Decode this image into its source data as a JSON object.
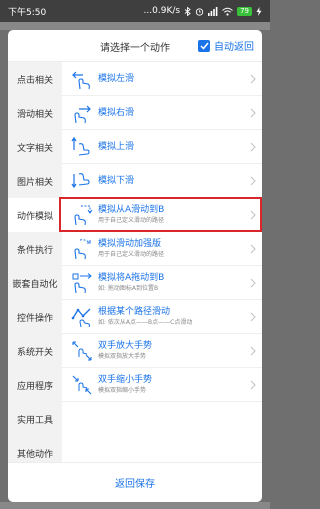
{
  "status": {
    "time": "下午5:50",
    "network": "...0.9K/s",
    "battery": "79"
  },
  "dialog": {
    "title": "请选择一个动作",
    "auto_return_label": "自动返回",
    "auto_return_checked": true,
    "save_label": "返回保存"
  },
  "sidebar": {
    "items": [
      {
        "label": "点击相关"
      },
      {
        "label": "滑动相关"
      },
      {
        "label": "文字相关"
      },
      {
        "label": "图片相关"
      },
      {
        "label": "动作模拟",
        "active": true
      },
      {
        "label": "条件执行"
      },
      {
        "label": "嵌套自动化"
      },
      {
        "label": "控件操作"
      },
      {
        "label": "系统开关"
      },
      {
        "label": "应用程序"
      },
      {
        "label": "实用工具"
      },
      {
        "label": "其他动作"
      }
    ]
  },
  "actions": [
    {
      "title": "模拟左滑",
      "subtitle": "",
      "icon": "swipe-left-icon"
    },
    {
      "title": "模拟右滑",
      "subtitle": "",
      "icon": "swipe-right-icon"
    },
    {
      "title": "模拟上滑",
      "subtitle": "",
      "icon": "swipe-up-icon"
    },
    {
      "title": "模拟下滑",
      "subtitle": "",
      "icon": "swipe-down-icon"
    },
    {
      "title": "模拟从A滑动到B",
      "subtitle": "用于自己定义滑动的路径",
      "icon": "swipe-a-to-b-icon",
      "highlighted": true
    },
    {
      "title": "模拟滑动加强版",
      "subtitle": "用于自己定义滑动的路径",
      "icon": "swipe-enhanced-icon"
    },
    {
      "title": "模拟将A拖动到B",
      "subtitle": "如: 拖动图标A到位置B",
      "icon": "drag-a-to-b-icon"
    },
    {
      "title": "根据某个路径滑动",
      "subtitle": "如: 依次从A点——B点——C点滑动",
      "icon": "path-swipe-icon"
    },
    {
      "title": "双手放大手势",
      "subtitle": "模拟双指放大手势",
      "icon": "pinch-zoom-in-icon"
    },
    {
      "title": "双手缩小手势",
      "subtitle": "模拟双指缩小手势",
      "icon": "pinch-zoom-out-icon"
    }
  ],
  "colors": {
    "accent": "#1a73e8",
    "highlight": "#d8262a"
  }
}
